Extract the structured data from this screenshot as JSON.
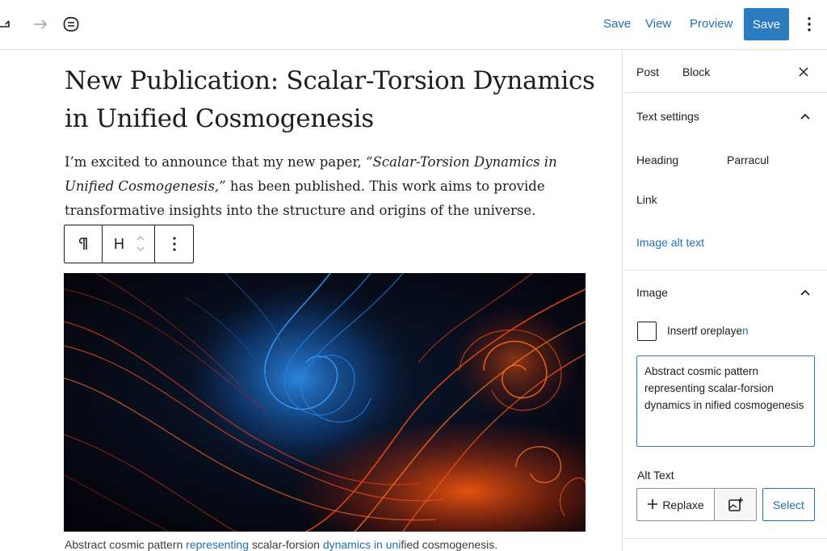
{
  "toolbar": {
    "save_link": "Save",
    "view_link": "View",
    "preview_link": "Proview",
    "save_button": "Save"
  },
  "post": {
    "title": "New Publication: Scalar-Torsion Dynamics in Unified Cosmogenesis",
    "para_1": "I’m excited to announce that my new paper, ",
    "para_italic": "“Scalar-Torsion Dynamics in Unified Cosmogenesis,”",
    "para_2": " has been published. This work aims to provide transformative insights into the structure and origins of the universe."
  },
  "block_toolbar": {
    "heading_letter": "H"
  },
  "caption": {
    "part_1": "Abstract cosmic pattern ",
    "link_1": "representing",
    "part_2": " scalar-forsion ",
    "link_2": "dynamics in uni",
    "part_3": "fied cosmogenesis."
  },
  "sidebar": {
    "tab_post": "Post",
    "tab_block": "Block",
    "text_settings_title": "Text settings",
    "heading_option": "Heading",
    "parracul_option": "Parracul",
    "link_option": "Link",
    "image_alt_link": "Image alt text",
    "image_title": "Image",
    "checkbox_label_1": "Insertf ore",
    "checkbox_label_2": "playe",
    "checkbox_label_link": "n",
    "alt_textarea_value": "Abstract cosmic pattern representing scalar-forsion dynamics in nified cosmogenesis",
    "alt_text_label": "Alt Text",
    "replace_button": "Replaxe",
    "select_button": "Select"
  },
  "colors": {
    "accent": "#2271b1",
    "save_button_bg": "#2b7bc0"
  },
  "icons": [
    "undo-icon",
    "redo-icon",
    "tools-icon",
    "more-vertical-icon",
    "paragraph-icon",
    "chevron-up-down-icon",
    "close-icon",
    "chevron-up-icon",
    "plus-icon",
    "upload-image-icon"
  ]
}
